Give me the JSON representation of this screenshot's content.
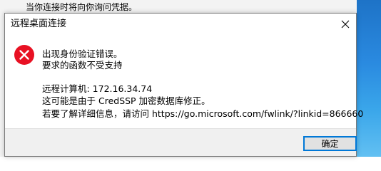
{
  "background": {
    "partial_text": "当你连接时将向你询问凭据。"
  },
  "dialog": {
    "title": "远程桌面连接",
    "icon": "error-icon",
    "messages": {
      "line1": "出现身份验证错误。",
      "line2": "要求的函数不受支持",
      "line3": "远程计算机: 172.16.34.74",
      "line4": "这可能是由于 CredSSP 加密数据库修正。",
      "line5": "若要了解详细信息，请访问 https://go.microsoft.com/fwlink/?linkid=866660"
    },
    "ok_label": "确定"
  },
  "colors": {
    "error_red": "#e81123",
    "focus_blue": "#0078d7"
  }
}
